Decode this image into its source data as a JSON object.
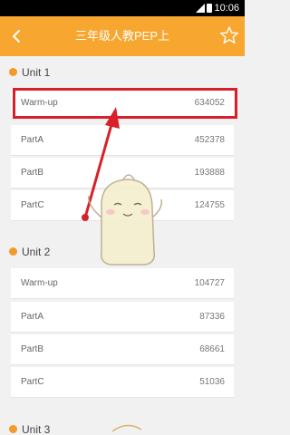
{
  "status": {
    "time": "10:06"
  },
  "header": {
    "title": "三年级人教PEP上"
  },
  "units": [
    {
      "label": "Unit 1",
      "items": [
        {
          "name": "Warm-up",
          "count": "634052"
        },
        {
          "name": "PartA",
          "count": "452378"
        },
        {
          "name": "PartB",
          "count": "193888"
        },
        {
          "name": "PartC",
          "count": "124755"
        }
      ]
    },
    {
      "label": "Unit 2",
      "items": [
        {
          "name": "Warm-up",
          "count": "104727"
        },
        {
          "name": "PartA",
          "count": "87336"
        },
        {
          "name": "PartB",
          "count": "68661"
        },
        {
          "name": "PartC",
          "count": "51036"
        }
      ]
    },
    {
      "label": "Unit 3"
    }
  ],
  "colors": {
    "header": "#f7a62f",
    "dot": "#f39a2a",
    "highlight": "#d8202a"
  }
}
